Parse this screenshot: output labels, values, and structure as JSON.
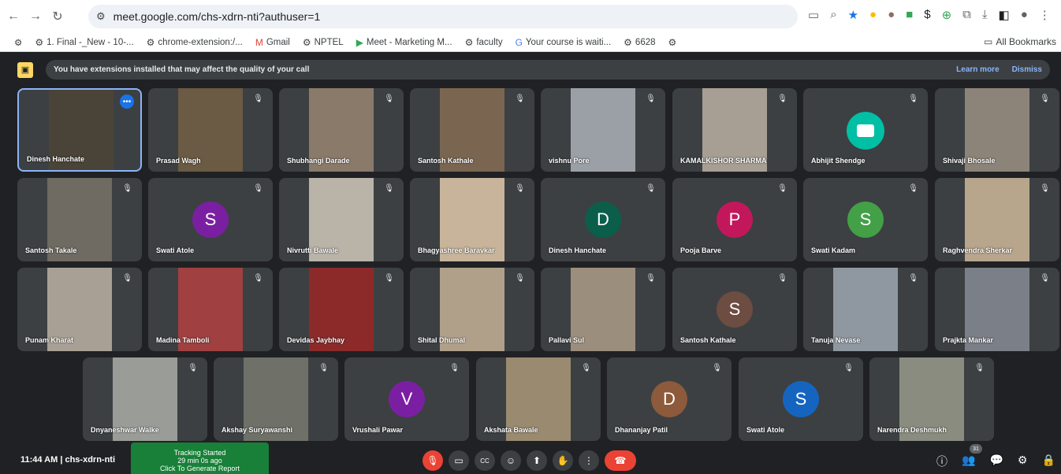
{
  "browser": {
    "url": "meet.google.com/chs-xdrn-nti?authuser=1",
    "bookmarks": [
      "1. Final -_New - 10-...",
      "chrome-extension:/...",
      "Gmail",
      "NPTEL",
      "Meet - Marketing M...",
      "faculty",
      "Your course is waiti...",
      "6628"
    ],
    "all_bookmarks": "All Bookmarks"
  },
  "banner": {
    "message": "You have extensions installed that may affect the quality of your call",
    "learn_more": "Learn more",
    "dismiss": "Dismiss"
  },
  "participants": [
    {
      "name": "Dinesh Hanchate",
      "type": "video",
      "bg": "#4a4438"
    },
    {
      "name": "Prasad Wagh",
      "type": "video",
      "bg": "#6b5a44"
    },
    {
      "name": "Shubhangi Darade",
      "type": "video",
      "bg": "#8a7a6a"
    },
    {
      "name": "Santosh Kathale",
      "type": "video",
      "bg": "#7a6650"
    },
    {
      "name": "vishnu Pore",
      "type": "video",
      "bg": "#9aa0a6"
    },
    {
      "name": "KAMALKISHOR SHARMA",
      "type": "video",
      "bg": "#a79f94"
    },
    {
      "name": "Abhijit Shendge",
      "type": "logo"
    },
    {
      "name": "Shivaji Bhosale",
      "type": "video",
      "bg": "#8c8478"
    },
    {
      "name": "Santosh Takale",
      "type": "video",
      "bg": "#6f6a62"
    },
    {
      "name": "Swati Atole",
      "type": "avatar",
      "initial": "S",
      "color": "#7b1fa2"
    },
    {
      "name": "Nivrutti Bawale",
      "type": "video",
      "bg": "#b9b3a8"
    },
    {
      "name": "Bhagyashree Baravkar",
      "type": "video",
      "bg": "#c7b49a"
    },
    {
      "name": "Dinesh Hanchate",
      "type": "avatar",
      "initial": "D",
      "color": "#0b5e4a"
    },
    {
      "name": "Pooja Barve",
      "type": "avatar",
      "initial": "P",
      "color": "#c2185b"
    },
    {
      "name": "Swati Kadam",
      "type": "avatar",
      "initial": "S",
      "color": "#43a047"
    },
    {
      "name": "Raghvendra Sherkar",
      "type": "video",
      "bg": "#b7a58c"
    },
    {
      "name": "Punam Kharat",
      "type": "video",
      "bg": "#a8a094"
    },
    {
      "name": "Madina Tamboli",
      "type": "video",
      "bg": "#a04040"
    },
    {
      "name": "Devidas Jaybhay",
      "type": "video",
      "bg": "#8c2a2a"
    },
    {
      "name": "Shital Dhumal",
      "type": "video",
      "bg": "#b0a08a"
    },
    {
      "name": "Pallavi Sul",
      "type": "video",
      "bg": "#9c8e7c"
    },
    {
      "name": "Santosh Kathale",
      "type": "avatar",
      "initial": "S",
      "color": "#6d4c41"
    },
    {
      "name": "Tanuja Nevase",
      "type": "video",
      "bg": "#8f98a0"
    },
    {
      "name": "Prajkta Mankar",
      "type": "video",
      "bg": "#7a7f88"
    },
    {
      "name": "Dnyaneshwar Walke",
      "type": "video",
      "bg": "#9a9c98"
    },
    {
      "name": "Akshay Suryawanshi",
      "type": "video",
      "bg": "#6f7068"
    },
    {
      "name": "Vrushali Pawar",
      "type": "avatar",
      "initial": "V",
      "color": "#7b1fa2"
    },
    {
      "name": "Akshata Bawale",
      "type": "video",
      "bg": "#9a8a70"
    },
    {
      "name": "Dhananjay Patil",
      "type": "avatar",
      "initial": "D",
      "color": "#8d5a3c"
    },
    {
      "name": "Swati Atole",
      "type": "avatar",
      "initial": "S",
      "color": "#1565c0"
    },
    {
      "name": "Narendra Deshmukh",
      "type": "video",
      "bg": "#8a8c80"
    }
  ],
  "footer": {
    "time_meeting": "11:44 AM  |  chs-xdrn-nti",
    "tracking_line1": "Tracking Started",
    "tracking_line2": "29 min 0s ago",
    "tracking_line3": "Click To Generate Report",
    "participant_count": "31"
  },
  "icons": {
    "mic_off": "🎙",
    "camera": "▭",
    "captions": "CC",
    "emoji": "☺",
    "present": "⬆",
    "raise_hand": "✋",
    "more": "⋮",
    "end_call": "☎",
    "info": "ⓘ",
    "people": "👥",
    "chat": "💬",
    "activities": "⚙",
    "host": "🔒"
  }
}
